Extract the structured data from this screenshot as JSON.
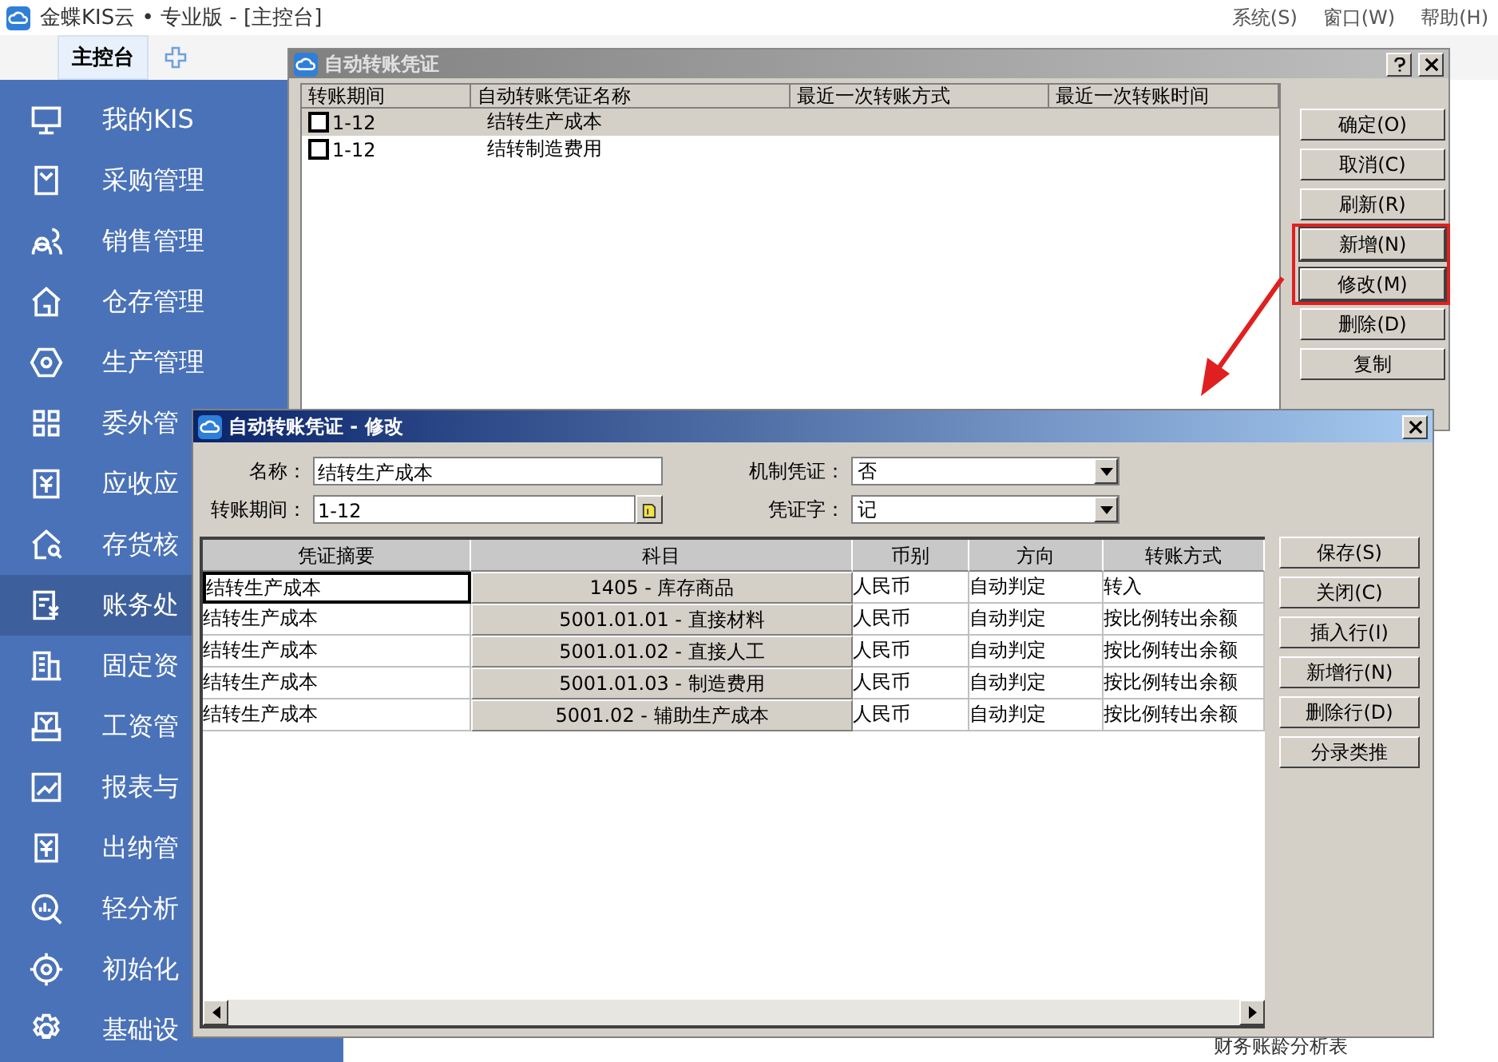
{
  "app": {
    "title": "金蝶KIS云 • 专业版 - [主控台]",
    "menu": [
      "系统(S)",
      "窗口(W)",
      "帮助(H)"
    ]
  },
  "tabs": [
    {
      "label": "主控台",
      "selected": true
    }
  ],
  "sidebar": {
    "items": [
      {
        "label": "我的KIS",
        "selected": false
      },
      {
        "label": "采购管理",
        "selected": false
      },
      {
        "label": "销售管理",
        "selected": false
      },
      {
        "label": "仓存管理",
        "selected": false
      },
      {
        "label": "生产管理",
        "selected": false
      },
      {
        "label": "委外管",
        "selected": false
      },
      {
        "label": "应收应",
        "selected": false
      },
      {
        "label": "存货核",
        "selected": false
      },
      {
        "label": "账务处",
        "selected": true
      },
      {
        "label": "固定资",
        "selected": false
      },
      {
        "label": "工资管",
        "selected": false
      },
      {
        "label": "报表与",
        "selected": false
      },
      {
        "label": "出纳管",
        "selected": false
      },
      {
        "label": "轻分析",
        "selected": false
      },
      {
        "label": "初始化",
        "selected": false
      },
      {
        "label": "基础设",
        "selected": false
      }
    ]
  },
  "background": {
    "report_label": "财务账龄分析表"
  },
  "transfer_list_dialog": {
    "title": "自动转账凭证",
    "columns": [
      "转账期间",
      "自动转账凭证名称",
      "最近一次转账方式",
      "最近一次转账时间"
    ],
    "rows": [
      {
        "period": "1-12",
        "name": "结转生产成本",
        "checked": false,
        "selected": true
      },
      {
        "period": "1-12",
        "name": "结转制造费用",
        "checked": false,
        "selected": false
      }
    ],
    "buttons": [
      {
        "label": "确定(O)",
        "highlighted": false
      },
      {
        "label": "取消(C)",
        "highlighted": false
      },
      {
        "label": "刷新(R)",
        "highlighted": false
      },
      {
        "label": "新增(N)",
        "highlighted": true
      },
      {
        "label": "修改(M)",
        "highlighted": true
      },
      {
        "label": "删除(D)",
        "highlighted": false
      },
      {
        "label": "复制",
        "highlighted": false
      }
    ]
  },
  "edit_dialog": {
    "title": "自动转账凭证 - 修改",
    "name_field": {
      "label": "名称：",
      "value": "结转生产成本"
    },
    "period_field": {
      "label": "转账期间：",
      "value": "1-12"
    },
    "auto_voucher_field": {
      "label": "机制凭证：",
      "value": "否"
    },
    "voucher_word_field": {
      "label": "凭证字：",
      "value": "记"
    },
    "columns": [
      "凭证摘要",
      "科目",
      "币别",
      "方向",
      "转账方式"
    ],
    "rows": [
      {
        "summary": "结转生产成本",
        "account": "1405 - 库存商品",
        "currency": "人民币",
        "direction": "自动判定",
        "method": "转入",
        "selected": true
      },
      {
        "summary": "结转生产成本",
        "account": "5001.01.01 - 直接材料",
        "currency": "人民币",
        "direction": "自动判定",
        "method": "按比例转出余额",
        "selected": false
      },
      {
        "summary": "结转生产成本",
        "account": "5001.01.02 - 直接人工",
        "currency": "人民币",
        "direction": "自动判定",
        "method": "按比例转出余额",
        "selected": false
      },
      {
        "summary": "结转生产成本",
        "account": "5001.01.03 - 制造费用",
        "currency": "人民币",
        "direction": "自动判定",
        "method": "按比例转出余额",
        "selected": false
      },
      {
        "summary": "结转生产成本",
        "account": "5001.02 - 辅助生产成本",
        "currency": "人民币",
        "direction": "自动判定",
        "method": "按比例转出余额",
        "selected": false
      }
    ],
    "buttons": [
      "保存(S)",
      "关闭(C)",
      "插入行(I)",
      "新增行(N)",
      "删除行(D)",
      "分录类推"
    ]
  }
}
